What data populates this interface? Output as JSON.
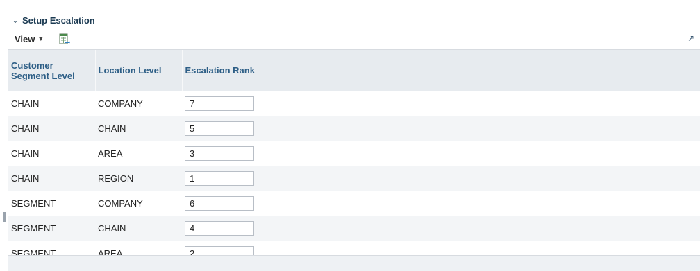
{
  "panel": {
    "title": "Setup Escalation"
  },
  "toolbar": {
    "view_label": "View"
  },
  "table": {
    "columns": [
      "Customer Segment Level",
      "Location Level",
      "Escalation Rank"
    ],
    "rows": [
      {
        "segment": "CHAIN",
        "location": "COMPANY",
        "rank": "7"
      },
      {
        "segment": "CHAIN",
        "location": "CHAIN",
        "rank": "5"
      },
      {
        "segment": "CHAIN",
        "location": "AREA",
        "rank": "3"
      },
      {
        "segment": "CHAIN",
        "location": "REGION",
        "rank": "1"
      },
      {
        "segment": "SEGMENT",
        "location": "COMPANY",
        "rank": "6"
      },
      {
        "segment": "SEGMENT",
        "location": "CHAIN",
        "rank": "4"
      },
      {
        "segment": "SEGMENT",
        "location": "AREA",
        "rank": "2"
      }
    ]
  },
  "icons": {
    "collapse": "chevron-down-icon",
    "view_caret": "caret-down-icon",
    "export": "export-to-excel-icon",
    "detach": "detach-icon"
  }
}
